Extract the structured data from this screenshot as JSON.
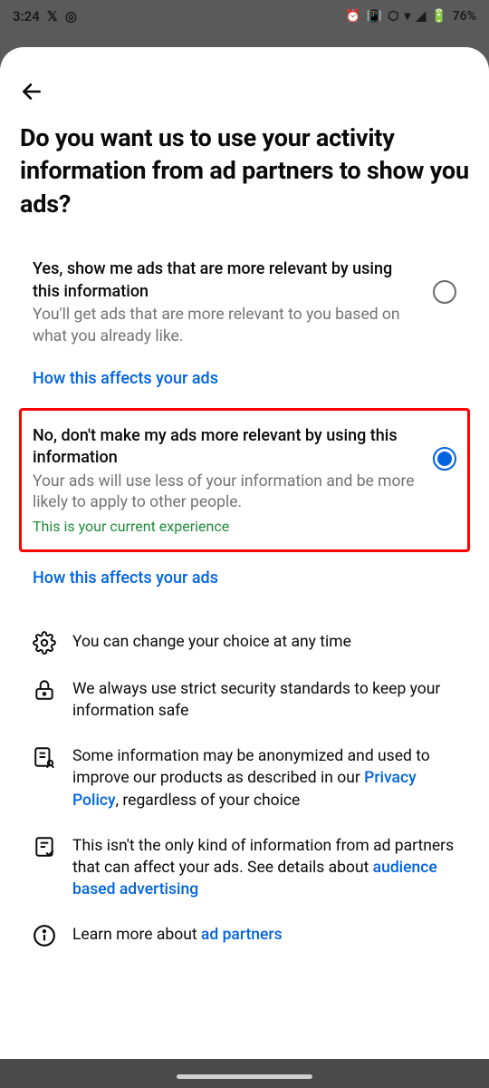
{
  "status": {
    "time": "3:24",
    "battery": "76%"
  },
  "title": "Do you want us to use your activity information from ad partners to show you ads?",
  "option_yes": {
    "title": "Yes, show me ads that are more relevant by using this information",
    "desc": "You'll get ads that are more relevant to you based on what you already like."
  },
  "option_no": {
    "title": "No, don't make my ads more relevant by using this information",
    "desc": "Your ads will use less of your information and be more likely to apply to other people.",
    "current": "This is your current experience"
  },
  "link_affects": "How this affects your ads",
  "info": {
    "change": "You can change your choice at any time",
    "security": "We always use strict security standards to keep your information safe",
    "anon_1": "Some information may be anonymized and used to improve our products as described in our ",
    "anon_link": "Privacy Policy",
    "anon_2": ", regardless of your choice",
    "other_1": "This isn't the only kind of information from ad partners that can affect your ads. See details about ",
    "other_link": "audience based advertising",
    "learn_1": "Learn more about ",
    "learn_link": "ad partners"
  }
}
